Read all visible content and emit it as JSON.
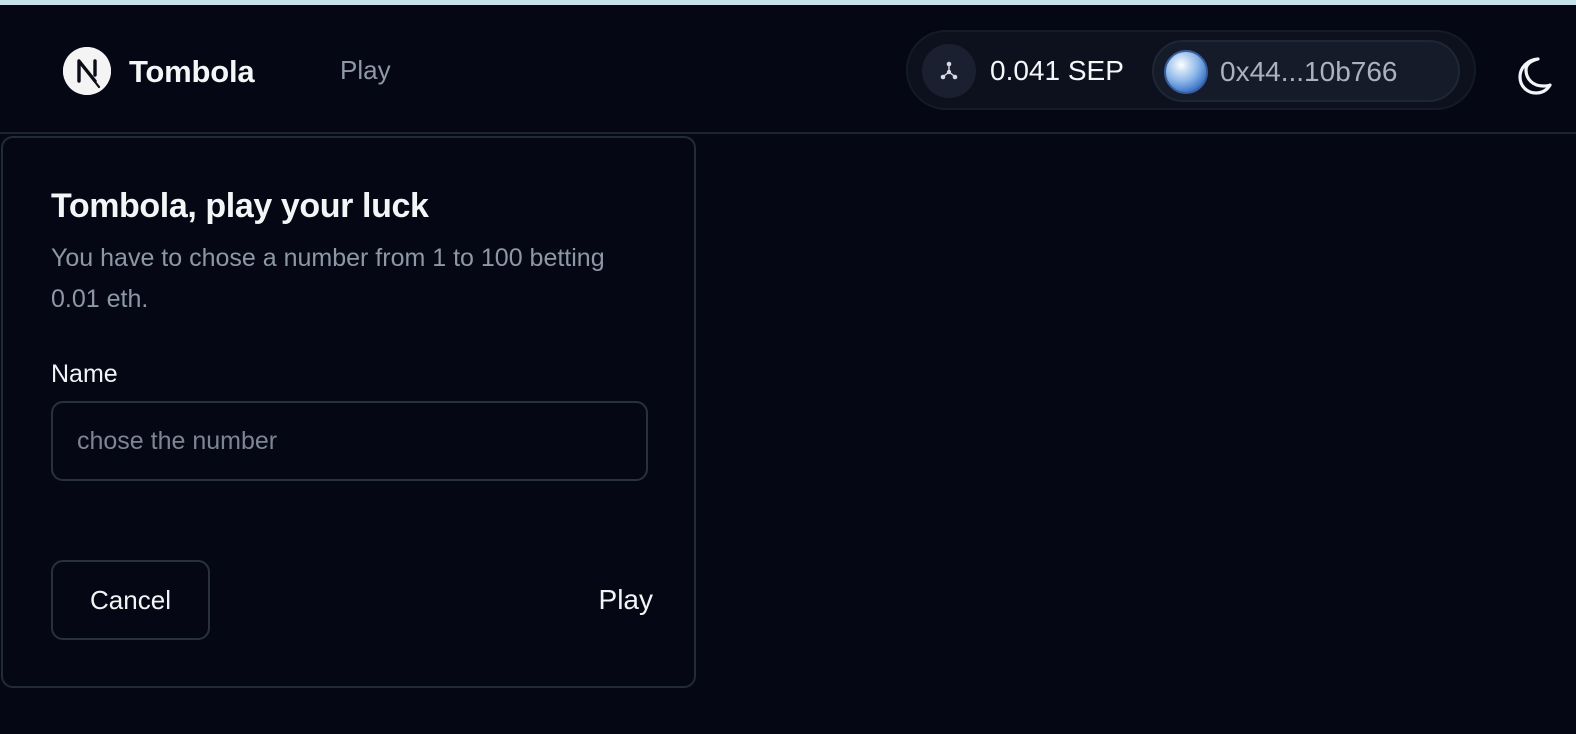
{
  "nav": {
    "logo_letter": "N",
    "brand": "Tombola",
    "links": [
      {
        "label": "Play"
      }
    ]
  },
  "wallet": {
    "network_icon": "network-icon",
    "balance": "0.041 SEP",
    "address": "0x44...10b766",
    "avatar_icon": "wallet-avatar-icon"
  },
  "theme": {
    "icon": "moon-icon"
  },
  "card": {
    "title": "Tombola, play your luck",
    "description": "You have to chose a number from 1 to 100 betting 0.01 eth.",
    "field": {
      "label": "Name",
      "placeholder": "chose the number",
      "value": ""
    },
    "actions": {
      "cancel_label": "Cancel",
      "play_label": "Play"
    }
  },
  "colors": {
    "background": "#050814",
    "border": "#232a38",
    "muted_text": "#8e97a6",
    "light_text": "#f1f3f7",
    "top_strip": "#c7e1ea"
  }
}
